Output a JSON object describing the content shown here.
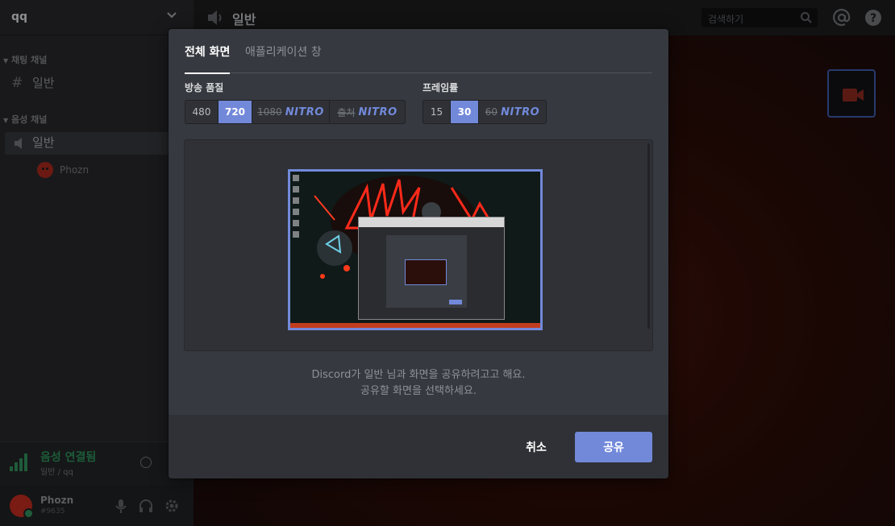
{
  "sidebar": {
    "server_name": "qq",
    "text_category": "채팅 채널",
    "text_channels": [
      {
        "name": "일반"
      }
    ],
    "voice_category": "음성 채널",
    "voice_channels": [
      {
        "name": "일반"
      }
    ],
    "voice_users": [
      {
        "name": "Phozn"
      }
    ]
  },
  "voice_panel": {
    "title": "음성 연결됨",
    "subtitle": "일반 / qq"
  },
  "user_panel": {
    "username": "Phozn",
    "tag": "#9635"
  },
  "topbar": {
    "channel_name": "일반",
    "search_placeholder": "검색하기"
  },
  "modal": {
    "tabs": [
      {
        "label": "전체 화면",
        "active": true
      },
      {
        "label": "애플리케이션 창",
        "active": false
      }
    ],
    "quality": {
      "label": "방송 품질",
      "options": [
        {
          "label": "480",
          "selected": false
        },
        {
          "label": "720",
          "selected": true
        },
        {
          "label": "1080",
          "locked": true,
          "badge": "NITRO"
        },
        {
          "label": "출처",
          "locked": true,
          "badge": "NITRO"
        }
      ]
    },
    "framerate": {
      "label": "프레임률",
      "options": [
        {
          "label": "15",
          "selected": false
        },
        {
          "label": "30",
          "selected": true
        },
        {
          "label": "60",
          "locked": true,
          "badge": "NITRO"
        }
      ]
    },
    "description_line1": "Discord가 일반 님과 화면을 공유하려고고 해요.",
    "description_line2": "공유할 화면을 선택하세요.",
    "cancel_label": "취소",
    "share_label": "공유"
  },
  "colors": {
    "accent": "#7289da",
    "modal_bg": "#36393f",
    "footer_bg": "#2f3136"
  }
}
